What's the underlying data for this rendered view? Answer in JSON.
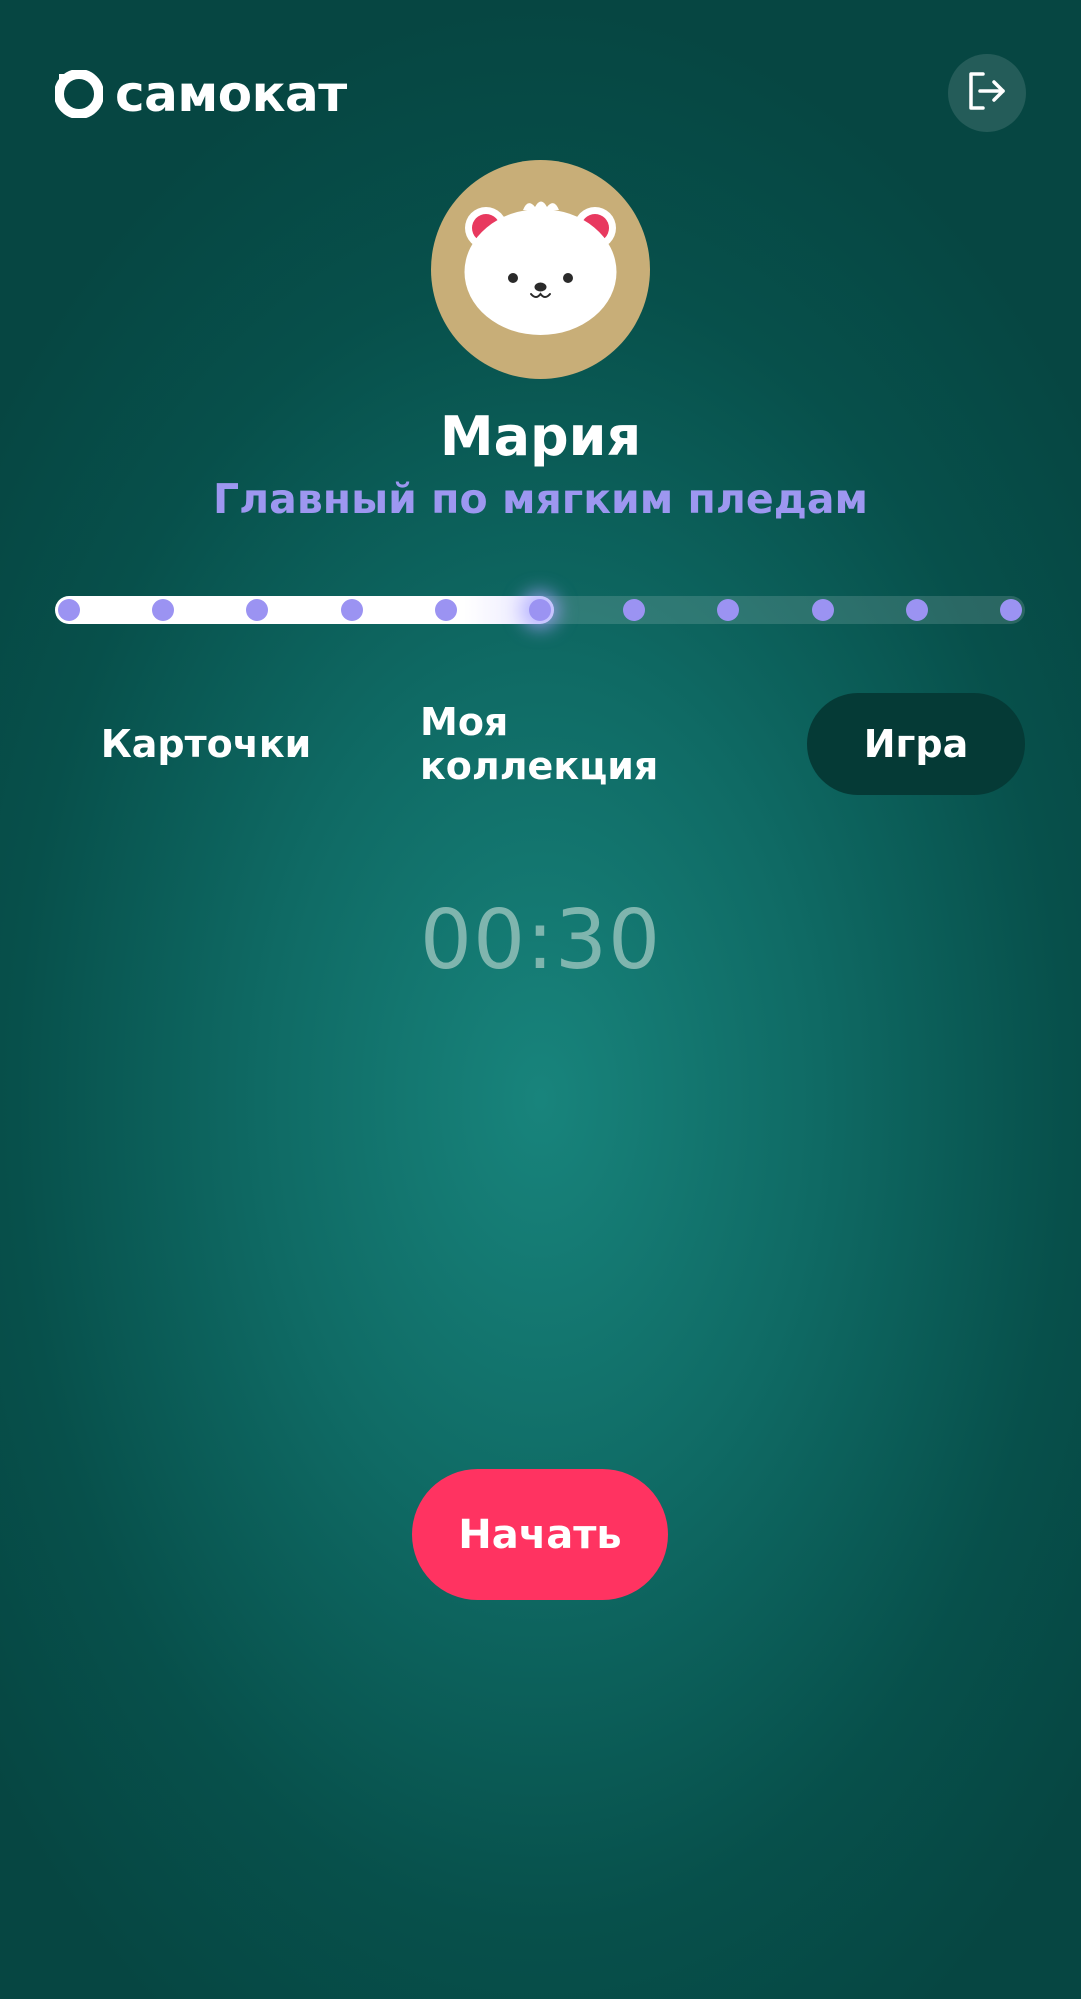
{
  "header": {
    "logo_text": "самокат",
    "logo_icon": "samokat-logo-icon",
    "logout_icon": "logout-icon"
  },
  "profile": {
    "avatar_icon": "polar-bear-avatar",
    "name": "Мария",
    "rank": "Главный по мягким пледам"
  },
  "progress": {
    "total_steps": 11,
    "current_step": 6
  },
  "tabs": [
    {
      "label": "Карточки",
      "active": false
    },
    {
      "label": "Моя коллекция",
      "active": false
    },
    {
      "label": "Игра",
      "active": true
    }
  ],
  "game": {
    "timer": "00:30",
    "start_label": "Начать"
  },
  "colors": {
    "accent": "#ff3361",
    "rank_text": "#9d97f0",
    "active_tab": "#053a36",
    "avatar_bg": "#c8ae78",
    "dot": "#9b93f2"
  }
}
